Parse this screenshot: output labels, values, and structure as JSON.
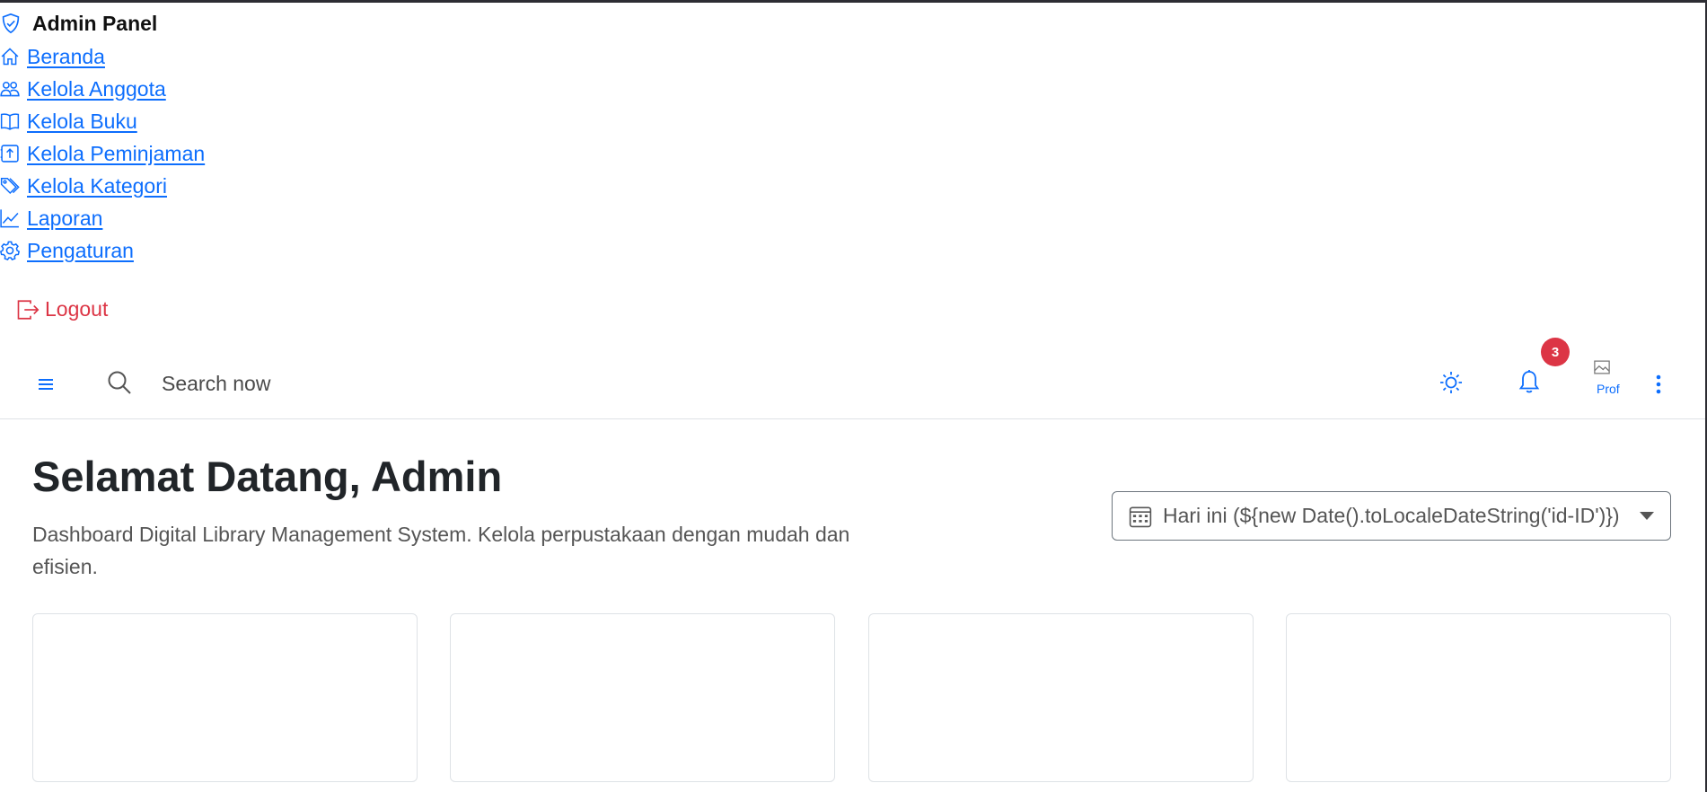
{
  "brand": {
    "title": "Admin Panel",
    "icon": "shield-check-icon"
  },
  "nav": {
    "items": [
      {
        "label": "Beranda",
        "icon": "house-icon"
      },
      {
        "label": "Kelola Anggota",
        "icon": "people-icon"
      },
      {
        "label": "Kelola Buku",
        "icon": "book-icon"
      },
      {
        "label": "Kelola Peminjaman",
        "icon": "box-arrow-up-icon"
      },
      {
        "label": "Kelola Kategori",
        "icon": "tags-icon"
      },
      {
        "label": "Laporan",
        "icon": "graph-up-icon"
      },
      {
        "label": "Pengaturan",
        "icon": "gear-icon"
      }
    ],
    "logout_label": "Logout"
  },
  "topbar": {
    "search_placeholder": "Search now",
    "notification_count": "3",
    "avatar_alt_text": "Prof"
  },
  "main": {
    "title": "Selamat Datang, Admin",
    "subtitle": "Dashboard Digital Library Management System. Kelola perpustakaan dengan mudah dan efisien.",
    "date_filter_label": "Hari ini (${new Date().toLocaleDateString('id-ID')})"
  },
  "colors": {
    "link": "#0d6efd",
    "danger": "#dc3545",
    "border": "#dee2e6"
  }
}
